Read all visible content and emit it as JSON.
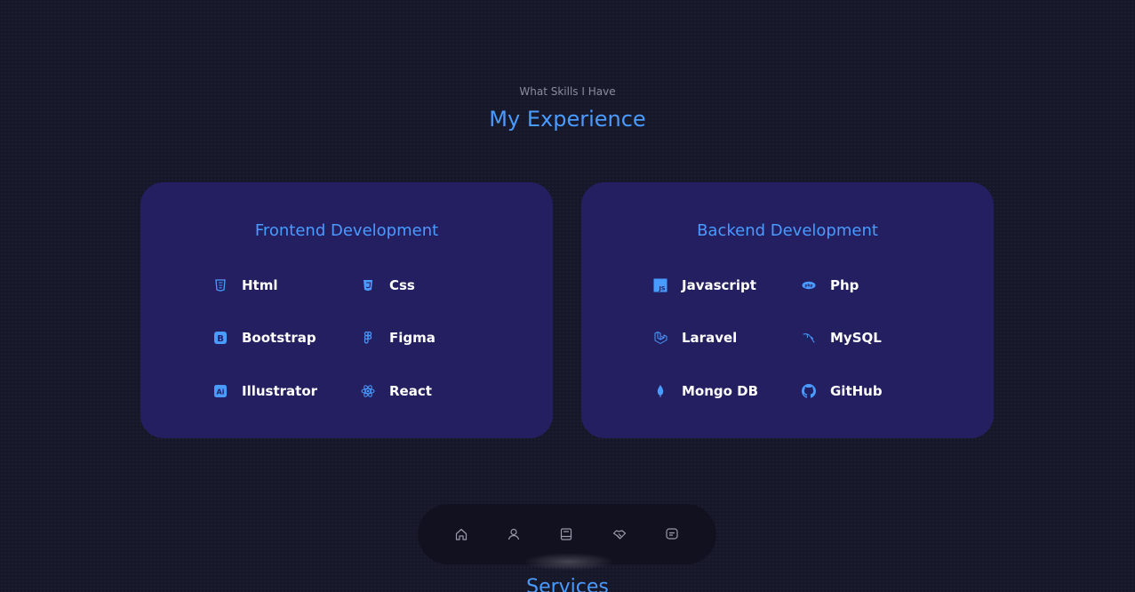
{
  "header": {
    "subtitle": "What Skills I Have",
    "title": "My Experience"
  },
  "frontend": {
    "title": "Frontend Development",
    "skills": [
      {
        "label": "Html",
        "icon": "html5-icon"
      },
      {
        "label": "Css",
        "icon": "css3-icon"
      },
      {
        "label": "Bootstrap",
        "icon": "bootstrap-icon"
      },
      {
        "label": "Figma",
        "icon": "figma-icon"
      },
      {
        "label": "Illustrator",
        "icon": "illustrator-icon"
      },
      {
        "label": "React",
        "icon": "react-icon"
      }
    ]
  },
  "backend": {
    "title": "Backend Development",
    "skills": [
      {
        "label": "Javascript",
        "icon": "javascript-icon"
      },
      {
        "label": "Php",
        "icon": "php-icon"
      },
      {
        "label": "Laravel",
        "icon": "laravel-icon"
      },
      {
        "label": "MySQL",
        "icon": "mysql-icon"
      },
      {
        "label": "Mongo DB",
        "icon": "mongodb-icon"
      },
      {
        "label": "GitHub",
        "icon": "github-icon"
      }
    ]
  },
  "nav": {
    "items": [
      {
        "icon": "home-icon"
      },
      {
        "icon": "user-icon"
      },
      {
        "icon": "book-icon"
      },
      {
        "icon": "handshake-icon"
      },
      {
        "icon": "message-icon"
      }
    ]
  },
  "next_section": {
    "title": "Services"
  },
  "colors": {
    "background": "#17172a",
    "card": "#231f60",
    "accent": "#4a9bff",
    "text": "#ffffff",
    "muted": "#8c8ca0",
    "nav": "#111120"
  }
}
